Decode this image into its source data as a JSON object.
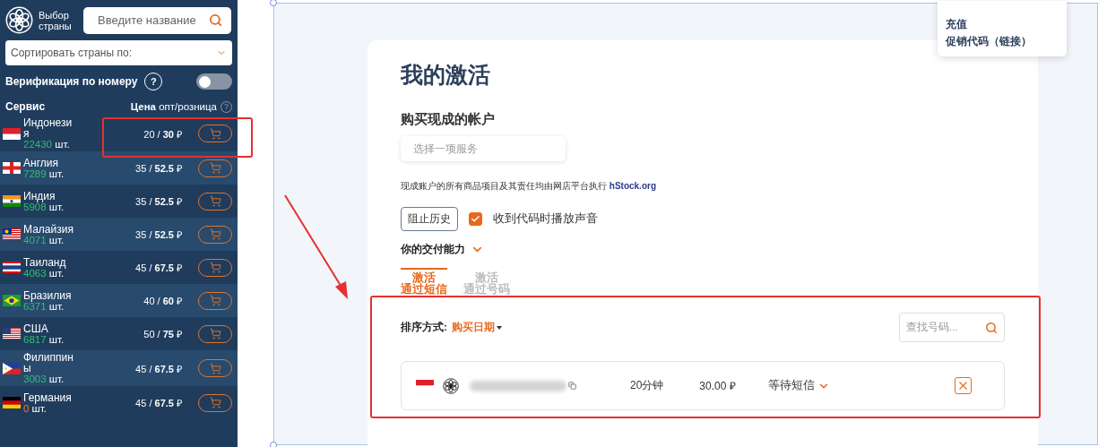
{
  "sidebar": {
    "logo_label": "Выбор страны",
    "search": {
      "placeholder": "Введите название"
    },
    "sort": {
      "placeholder": "Сортировать страны по:"
    },
    "verification": {
      "label": "Верификация по номеру",
      "help": "?",
      "on": false
    },
    "header": {
      "service": "Сервис",
      "price": "**Цена** опт/розница",
      "help": "?"
    },
    "countries": [
      {
        "kind": "id",
        "name": "Индонезия",
        "count": "22430",
        "unit": "шт.",
        "in_stock": true,
        "price": "20 / **30** ₽"
      },
      {
        "kind": "gb",
        "name": "Англия",
        "count": "7289",
        "unit": "шт.",
        "in_stock": true,
        "price": "35 / **52.5** ₽"
      },
      {
        "kind": "in",
        "name": "Индия",
        "count": "5908",
        "unit": "шт.",
        "in_stock": true,
        "price": "35 / **52.5** ₽"
      },
      {
        "kind": "my",
        "name": "Малайзия",
        "count": "4071",
        "unit": "шт.",
        "in_stock": true,
        "price": "35 / **52.5** ₽"
      },
      {
        "kind": "th",
        "name": "Таиланд",
        "count": "4063",
        "unit": "шт.",
        "in_stock": true,
        "price": "45 / **67.5** ₽"
      },
      {
        "kind": "br",
        "name": "Бразилия",
        "count": "6371",
        "unit": "шт.",
        "in_stock": true,
        "price": "40 / **60** ₽"
      },
      {
        "kind": "us",
        "name": "США",
        "count": "6817",
        "unit": "шт.",
        "in_stock": true,
        "price": "50 / **75** ₽"
      },
      {
        "kind": "ph",
        "name": "Филиппины",
        "count": "3003",
        "unit": "шт.",
        "in_stock": true,
        "price": "45 / **67.5** ₽"
      },
      {
        "kind": "de",
        "name": "Германия",
        "count": "0",
        "unit": "шт.",
        "in_stock": false,
        "price": "45 / **67.5** ₽"
      }
    ]
  },
  "menu": {
    "items": [
      "充值",
      "促销代码（链接）"
    ]
  },
  "main": {
    "title": "我的激活",
    "section": "购买现成的帐户",
    "service_select": {
      "placeholder": "选择一项服务"
    },
    "note": "现成账户的所有商品项目及其责任均由网店平台执行",
    "note_link": "hStock.org",
    "history_button": "阻止历史",
    "sound": {
      "label": "收到代码时播放声音",
      "checked": true
    },
    "delivery": {
      "label": "你的交付能力",
      "expanded": false
    },
    "tabs": [
      {
        "lines": [
          "激活",
          "通过短信"
        ],
        "selected": true
      },
      {
        "lines": [
          "激活",
          "通过号码"
        ],
        "selected": false
      }
    ],
    "sort": {
      "label": "排序方式:",
      "value": "购买日期"
    },
    "number_search": {
      "placeholder": "查找号码..."
    },
    "activations": [
      {
        "kind": "id",
        "time": "20分钟",
        "price": "30.00 ₽",
        "status": "等待短信"
      }
    ]
  }
}
